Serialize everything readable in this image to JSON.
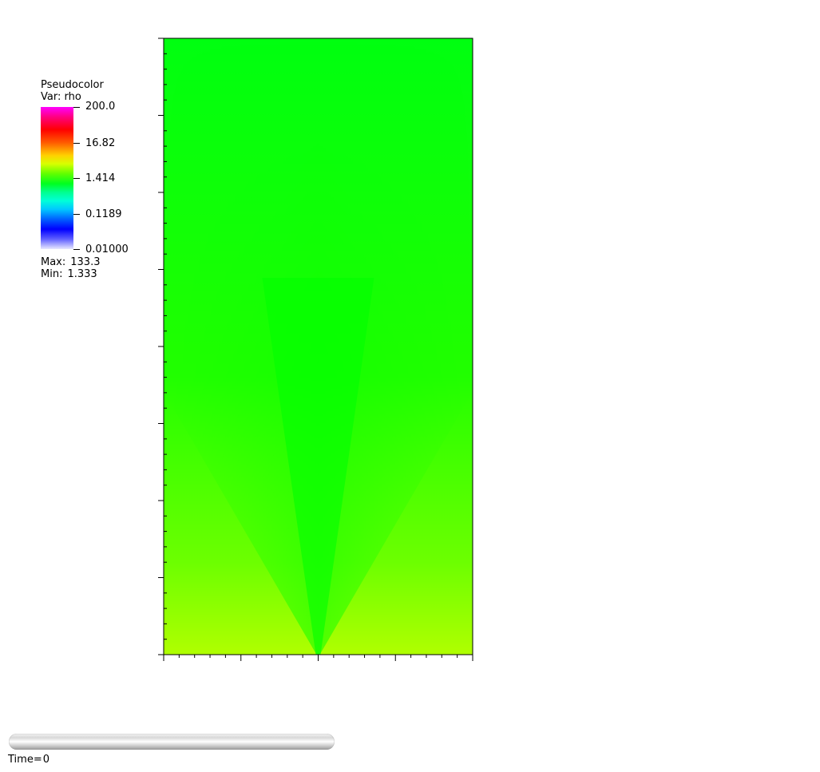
{
  "legend": {
    "title": "Pseudocolor",
    "var_label": "Var: rho",
    "ticks": [
      "200.0",
      "16.82",
      "1.414",
      "0.1189",
      "0.01000"
    ],
    "max_label": "Max:",
    "max_value": "133.3",
    "min_label": "Min:",
    "min_value": "1.333",
    "scale": "log"
  },
  "colors": {
    "field_top": "#00ff10",
    "field_bottom_corner": "#b0ff00",
    "apex_green": "#00ff00",
    "frame": "#000000"
  },
  "time": {
    "label": "Time=",
    "value": "0"
  },
  "chart_data": {
    "type": "heatmap",
    "variable": "rho",
    "colormap": "hot-to-cold rainbow, log scale",
    "color_range": [
      0.01,
      200.0
    ],
    "data_range": [
      1.333,
      133.3
    ],
    "x_major_ticks": 5,
    "y_major_ticks": 9,
    "grid": false,
    "legend_position": "top-left"
  }
}
